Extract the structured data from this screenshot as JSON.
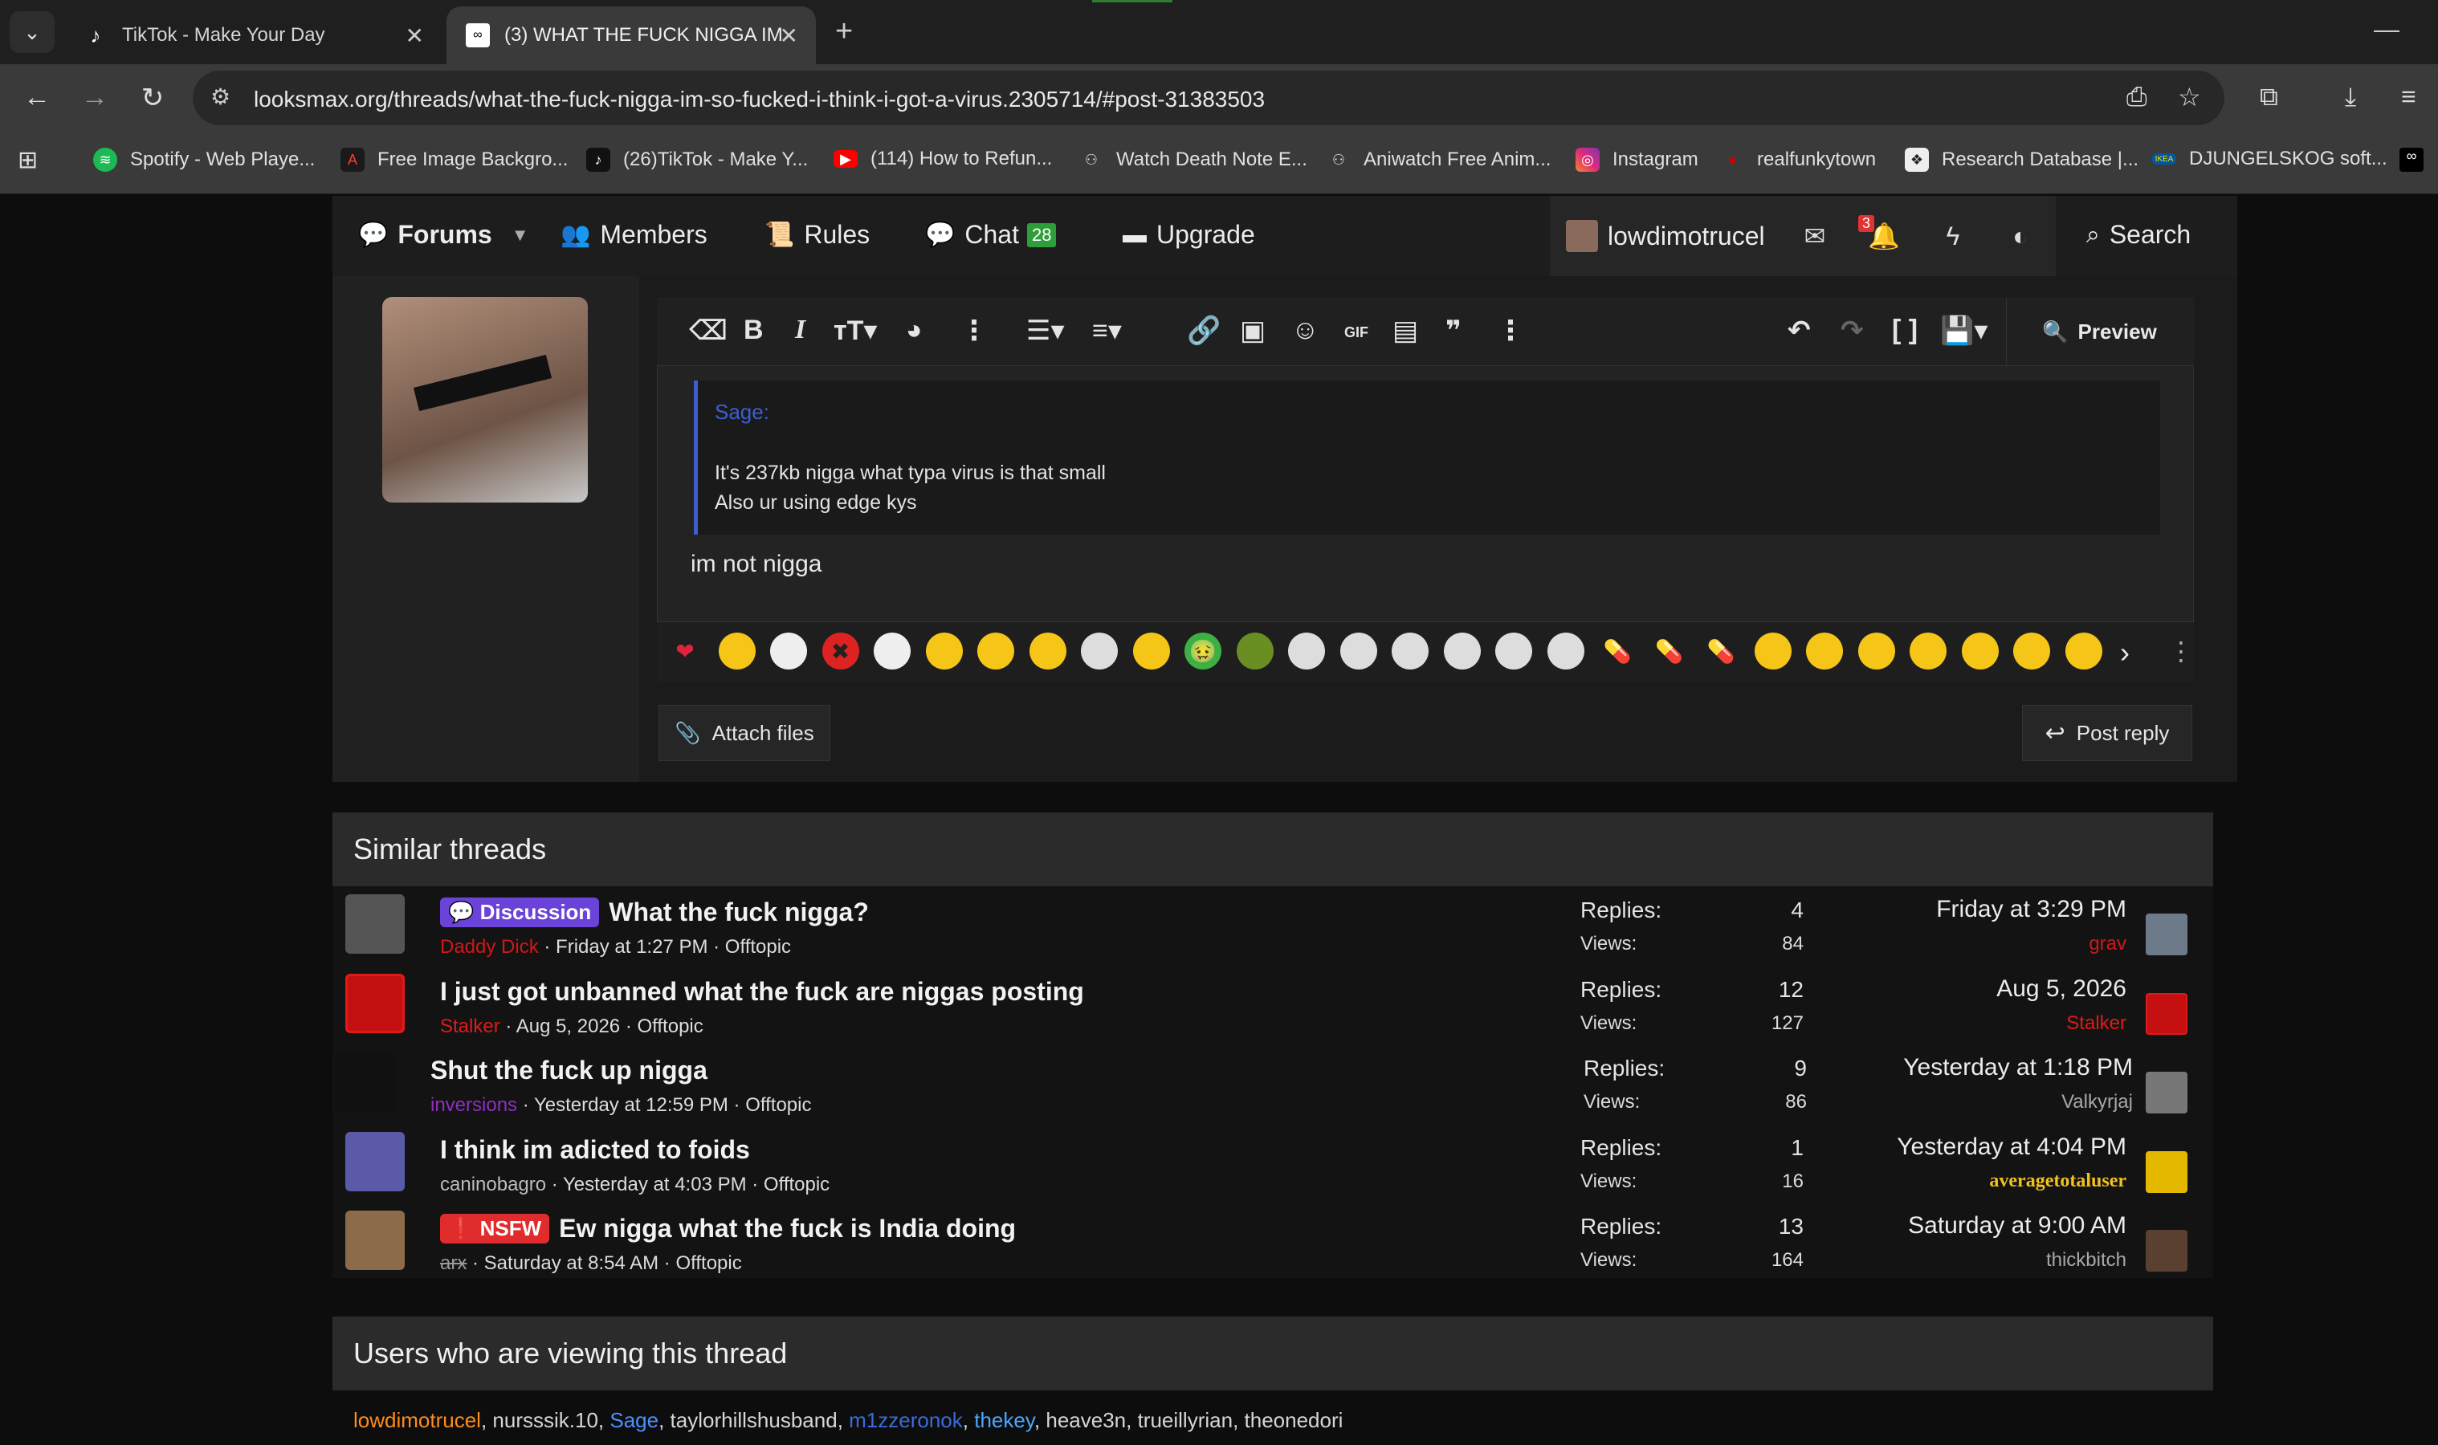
{
  "browser": {
    "tabs": [
      {
        "title": "TikTok - Make Your Day",
        "icon": "tiktok-icon"
      },
      {
        "title": "(3) WHAT THE FUCK NIGGA IM",
        "icon": "looksmax-icon"
      }
    ],
    "url": "looksmax.org/threads/what-the-fuck-nigga-im-so-fucked-i-think-i-got-a-virus.2305714/#post-31383503",
    "bookmarks": [
      {
        "label": "Spotify - Web Playe...",
        "icon": "spotify-icon",
        "color": "#1db954"
      },
      {
        "label": "Free Image Backgro...",
        "icon": "adobe-icon",
        "color": "#ff3a2f"
      },
      {
        "label": "(26)TikTok - Make Y...",
        "icon": "tiktok-icon",
        "color": "#111111"
      },
      {
        "label": "(114) How to Refun...",
        "icon": "youtube-icon",
        "color": "#ff0000"
      },
      {
        "label": "Watch Death Note E...",
        "icon": "aniwatch-icon",
        "color": "#dddddd"
      },
      {
        "label": "Aniwatch Free Anim...",
        "icon": "aniwatch-icon",
        "color": "#dddddd"
      },
      {
        "label": "Instagram",
        "icon": "instagram-icon",
        "color": "#e1306c"
      },
      {
        "label": "realfunkytown",
        "icon": "youtube-icon",
        "color": "#cc0000"
      },
      {
        "label": "Research Database |...",
        "icon": "database-icon",
        "color": "#eeeeee"
      },
      {
        "label": "DJUNGELSKOG soft...",
        "icon": "ikea-icon",
        "color": "#0058a3"
      }
    ]
  },
  "forum_nav": {
    "forums": "Forums",
    "members": "Members",
    "rules": "Rules",
    "chat": "Chat",
    "chat_count": "28",
    "upgrade": "Upgrade",
    "username": "lowdimotrucel",
    "notif_count": "3",
    "search": "Search"
  },
  "editor": {
    "preview": "Preview",
    "quote_author": "Sage:",
    "quote_line1": "It's 237kb nigga what typa virus is that small",
    "quote_line2": "Also ur using edge kys",
    "reply_text": "im not nigga",
    "attach": "Attach files",
    "post_reply": "Post reply"
  },
  "similar": {
    "heading": "Similar threads",
    "replies_label": "Replies:",
    "views_label": "Views:",
    "threads": [
      {
        "prefix": "Discussion",
        "prefix_type": "discussion",
        "title": "What the fuck nigga?",
        "author": "Daddy Dick",
        "author_color": "#d01818",
        "meta": "· Friday at 1:27 PM · Offtopic",
        "replies": "4",
        "views": "84",
        "last_date": "Friday at 3:29 PM",
        "last_user": "grav",
        "last_user_color": "#d01818"
      },
      {
        "prefix": "",
        "prefix_type": "",
        "title": "I just got unbanned what the fuck are niggas posting",
        "author": "Stalker",
        "author_color": "#e01a1a",
        "meta": "· Aug 5, 2026 · Offtopic",
        "replies": "12",
        "views": "127",
        "last_date": "Aug 5, 2026",
        "last_user": "Stalker",
        "last_user_color": "#e01a1a"
      },
      {
        "prefix": "",
        "prefix_type": "",
        "title": "Shut the fuck up nigga",
        "author": "inversions",
        "author_color": "#8e2fbf",
        "meta": "· Yesterday at 12:59 PM · Offtopic",
        "replies": "9",
        "views": "86",
        "last_date": "Yesterday at 1:18 PM",
        "last_user": "Valkyrjaj",
        "last_user_color": "#a8a8a8"
      },
      {
        "prefix": "",
        "prefix_type": "",
        "title": "I think im adicted to foids",
        "author": "caninobagro",
        "author_color": "#bdbdbd",
        "meta": "· Yesterday at 4:03 PM · Offtopic",
        "replies": "1",
        "views": "16",
        "last_date": "Yesterday at 4:04 PM",
        "last_user": "averagetotaluser",
        "last_user_color": "#f2c21b"
      },
      {
        "prefix": "NSFW",
        "prefix_type": "nsfw",
        "title": "Ew nigga what the fuck is India doing",
        "author": "arx",
        "author_color": "#9a9a9a",
        "meta": "· Saturday at 8:54 AM · Offtopic",
        "replies": "13",
        "views": "164",
        "last_date": "Saturday at 9:00 AM",
        "last_user": "thickbitch",
        "last_user_color": "#a8a8a8"
      }
    ]
  },
  "viewing": {
    "heading": "Users who are viewing this thread",
    "users": [
      {
        "name": "lowdimotrucel",
        "color": "#ff8c1a"
      },
      {
        "name": "nursssik.10",
        "color": "#d6d6d6"
      },
      {
        "name": "Sage",
        "color": "#4a90ff"
      },
      {
        "name": "taylorhillshusband",
        "color": "#d6d6d6"
      },
      {
        "name": "m1zzeronok",
        "color": "#3b6bd9"
      },
      {
        "name": "thekey",
        "color": "#4aa8ff"
      },
      {
        "name": "heave3n",
        "color": "#d6d6d6"
      },
      {
        "name": "trueillyrian",
        "color": "#d6d6d6"
      },
      {
        "name": "theonedori",
        "color": "#d6d6d6"
      }
    ]
  },
  "smilies": [
    "heart",
    "heart-eyes",
    "skull",
    "x",
    "skull2",
    "rofl",
    "cry",
    "joy",
    "face",
    "grin",
    "sick",
    "shrek",
    "face2",
    "face3",
    "face4",
    "face5",
    "face6",
    "face7",
    "pill",
    "redpill",
    "bluepill",
    "blush",
    "smile",
    "tongue",
    "grin2",
    "laugh",
    "rofl2",
    "joy2"
  ]
}
